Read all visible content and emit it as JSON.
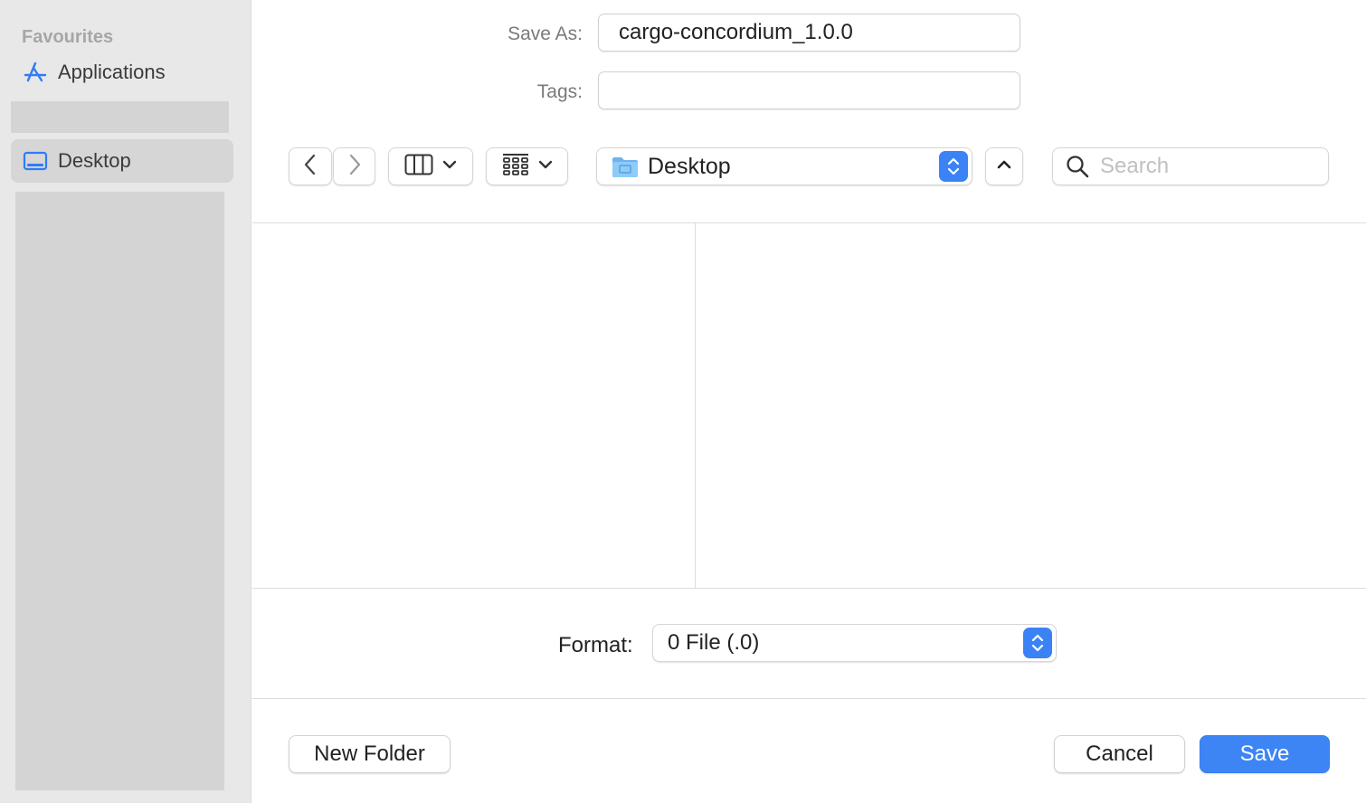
{
  "sidebar": {
    "section_title": "Favourites",
    "items": [
      {
        "label": "Applications",
        "icon": "applications-icon"
      },
      {
        "label": "Desktop",
        "icon": "desktop-icon",
        "selected": true
      }
    ]
  },
  "form": {
    "save_as_label": "Save As:",
    "save_as_value": "cargo-concordium_1.0.0",
    "tags_label": "Tags:",
    "tags_value": ""
  },
  "toolbar": {
    "location": "Desktop",
    "search_placeholder": "Search"
  },
  "format": {
    "label": "Format:",
    "value": "0 File (.0)"
  },
  "buttons": {
    "new_folder": "New Folder",
    "cancel": "Cancel",
    "save": "Save"
  },
  "colors": {
    "accent": "#3d84f5",
    "sidebar_bg": "#e8e8e8",
    "selected_bg": "#d6d6d6"
  }
}
